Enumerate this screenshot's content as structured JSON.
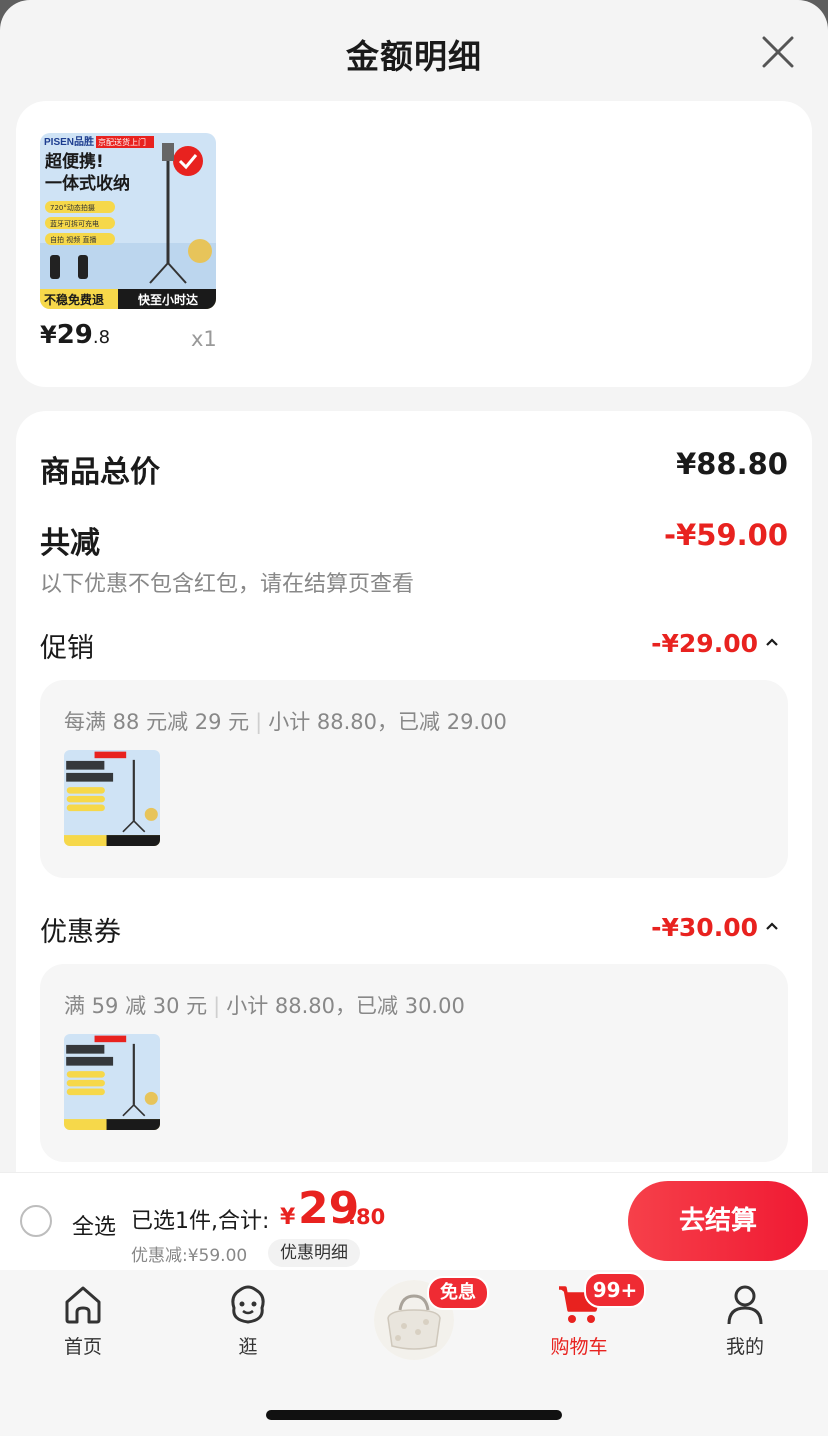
{
  "header": {
    "title": "金额明细"
  },
  "product": {
    "image": {
      "brand": "PISEN品胜",
      "tag": "京配送货上门",
      "headline1": "超便携!",
      "headline2": "一体式收纳",
      "feature1": "720°动态拍摄",
      "feature2": "蓝牙可拆可充电",
      "feature3": "自拍 视频 直播",
      "footer_left": "不稳免费退",
      "footer_right": "快至小时达"
    },
    "currency": "¥",
    "price_int": "29",
    "price_dec": ".8",
    "quantity": "x1"
  },
  "summary": {
    "total_label": "商品总价",
    "total_value": "¥88.80",
    "reduce_label": "共减",
    "reduce_value": "-¥59.00",
    "note": "以下优惠不包含红包，请在结算页查看"
  },
  "promo": {
    "title": "促销",
    "value": "-¥29.00",
    "rule": "每满 88 元减 29 元",
    "subtotal": "小计 88.80，已减 29.00"
  },
  "coupon": {
    "title": "优惠券",
    "value": "-¥30.00",
    "rule": "满 59 减 30 元",
    "subtotal": "小计 88.80，已减 30.00"
  },
  "bottom_bar": {
    "select_all": "全选",
    "selected_text": "已选1件,合计:",
    "total_currency": "¥",
    "total_int": "29",
    "total_dec": ".80",
    "discount_text": "优惠减:¥59.00",
    "detail_chip": "优惠明细",
    "checkout_label": "去结算"
  },
  "tabs": [
    {
      "label": "首页",
      "icon": "home-icon"
    },
    {
      "label": "逛",
      "icon": "face-icon"
    },
    {
      "label": "",
      "icon": "handbag-icon",
      "badge": "免息"
    },
    {
      "label": "购物车",
      "icon": "cart-icon",
      "badge": "99+"
    },
    {
      "label": "我的",
      "icon": "person-icon"
    }
  ],
  "colors": {
    "accent_red": "#e8221f",
    "text_dark": "#1a1a1a",
    "text_gray": "#888888"
  }
}
